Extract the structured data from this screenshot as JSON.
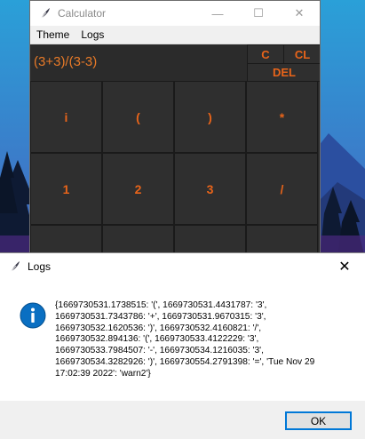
{
  "calculator": {
    "title": "Calculator",
    "menu": {
      "theme": "Theme",
      "logs": "Logs"
    },
    "expression": "(3+3)/(3-3)",
    "controls": {
      "clear": "C",
      "clear_line": "CL",
      "delete": "DEL"
    },
    "keys": [
      "i",
      "(",
      ")",
      "*",
      "1",
      "2",
      "3",
      "/",
      "",
      "",
      "",
      ""
    ],
    "window_buttons": {
      "minimize": "—",
      "maximize": "☐",
      "close": "✕"
    }
  },
  "dialog": {
    "title": "Logs",
    "message": "{1669730531.1738515: '(', 1669730531.4431787: '3',\n1669730531.7343786: '+', 1669730531.9670315: '3',\n1669730532.1620536: ')', 1669730532.4160821: '/',\n1669730532.894136: '(', 1669730533.4122229: '3',\n1669730533.7984507: '-', 1669730534.1216035: '3',\n1669730534.3282926: ')', 1669730554.2791398: '=', 'Tue Nov 29\n17:02:39 2022': 'warn2'}",
    "ok_label": "OK",
    "close_glyph": "✕"
  },
  "colors": {
    "accent_orange": "#e8641a",
    "calc_bg": "#2b2b2b",
    "info_blue": "#0067c0"
  }
}
